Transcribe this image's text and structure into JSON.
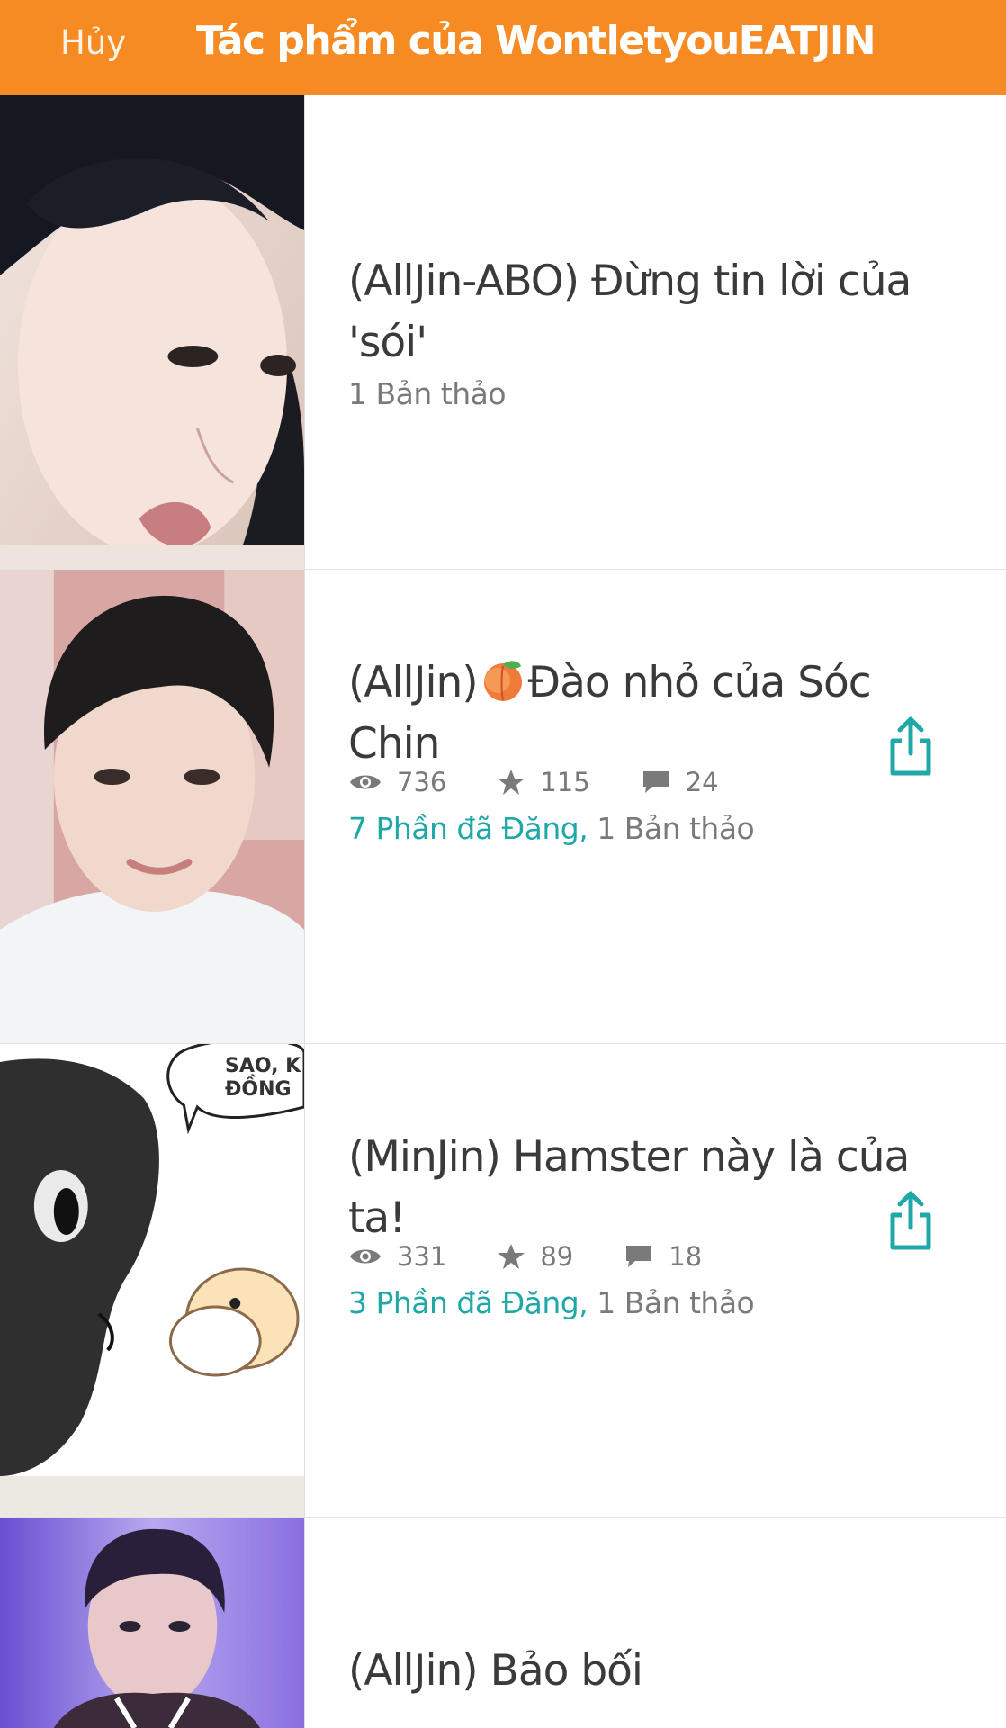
{
  "header": {
    "cancel_label": "Hủy",
    "title": "Tác phẩm của WontletyouEATJIN",
    "background": "#f68b24"
  },
  "accent_color": "#1fa8a7",
  "stories": [
    {
      "title": "(AllJin-ABO) Đừng tin lời của 'sói'",
      "drafts": "1 Bản thảo"
    },
    {
      "title_before_emoji": "(AllJin)",
      "title_emoji": "peach-icon",
      "title_after_emoji": "Đào nhỏ của Sóc Chin",
      "views": "736",
      "votes": "115",
      "comments": "24",
      "published": "7 Phần đã Đăng,",
      "drafts": "1 Bản thảo"
    },
    {
      "title": "(MinJin) Hamster này là của ta!",
      "views": "331",
      "votes": "89",
      "comments": "18",
      "published": "3 Phần đã Đăng,",
      "drafts": "1 Bản thảo"
    },
    {
      "title": "(AllJin) Bảo bối"
    }
  ]
}
